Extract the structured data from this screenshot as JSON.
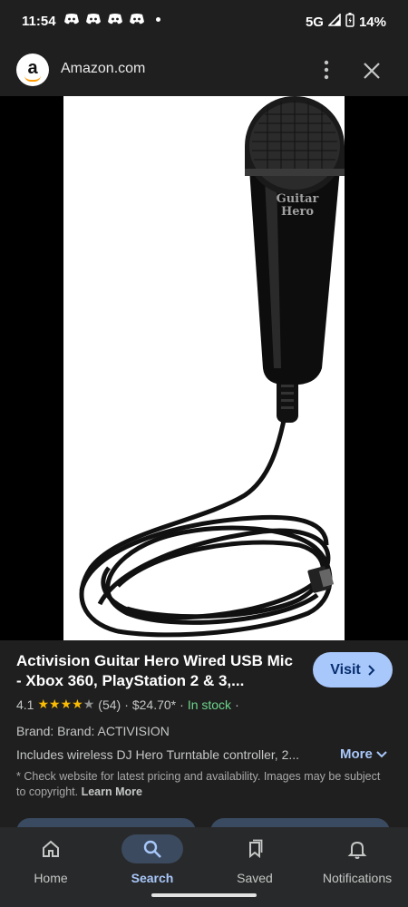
{
  "status": {
    "time": "11:54",
    "network": "5G",
    "battery": "14%"
  },
  "header": {
    "site_logo_letter": "a",
    "site_name": "Amazon.com"
  },
  "product": {
    "title": "Activision Guitar Hero Wired USB Mic - Xbox 360, PlayStation 2 & 3,...",
    "visit_label": "Visit",
    "rating": "4.1",
    "rating_value": 4.1,
    "rating_max": 5,
    "review_count": "(54)",
    "separator": "·",
    "price": "$24.70*",
    "stock": "In stock",
    "brand_line": "Brand: Brand: ACTIVISION",
    "description": "Includes wireless DJ Hero Turntable controller, 2...",
    "more_label": "More",
    "disclaimer": "* Check website for latest pricing and availability. Images may be subject to copyright.",
    "learn_more": "Learn More"
  },
  "image": {
    "logo_text_line1": "Guitar",
    "logo_text_line2": "Hero"
  },
  "nav": {
    "items": [
      {
        "label": "Home",
        "icon": "home-icon"
      },
      {
        "label": "Search",
        "icon": "search-icon"
      },
      {
        "label": "Saved",
        "icon": "saved-icon"
      },
      {
        "label": "Notifications",
        "icon": "bell-icon"
      }
    ],
    "active": "Search"
  },
  "colors": {
    "accent": "#a8c7fa",
    "stock_green": "#6dd58c",
    "star": "#fbbc04"
  }
}
